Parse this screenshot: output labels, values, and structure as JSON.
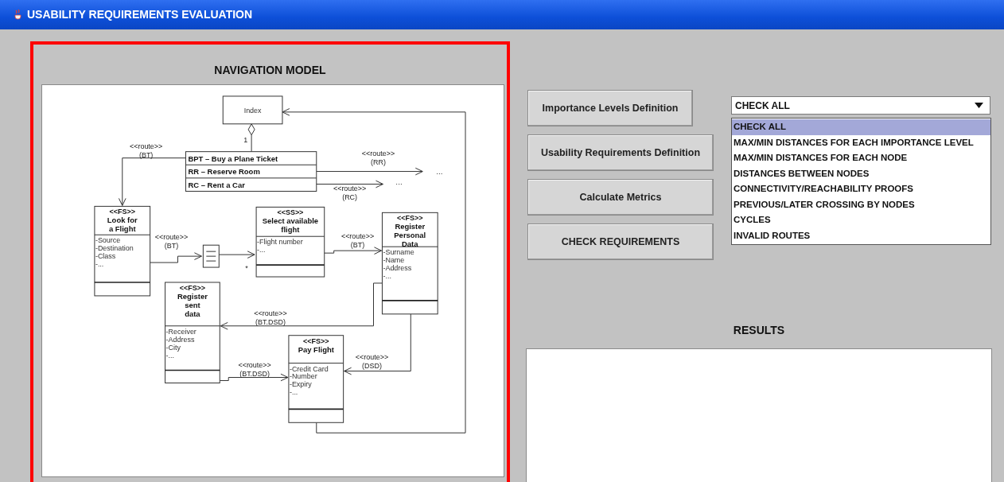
{
  "window": {
    "title": "USABILITY REQUIREMENTS EVALUATION"
  },
  "navigation_model": {
    "title": "NAVIGATION MODEL",
    "diagram": {
      "nodes": [
        {
          "kind": "index",
          "name": "Index"
        },
        {
          "kind": "menu",
          "rows": [
            "BPT – Buy a Plane Ticket",
            "RR – Reserve Room",
            "RC – Rent a Car"
          ]
        },
        {
          "kind": "class",
          "stereotype": "<<FS>>",
          "title_lines": [
            "Look for",
            "a Flight"
          ],
          "attributes": [
            "-Source",
            "-Destination",
            "-Class",
            "-..."
          ]
        },
        {
          "kind": "class",
          "stereotype": "<<SS>>",
          "title_lines": [
            "Select available",
            "flight"
          ],
          "attributes": [
            "-Flight number",
            "-..."
          ]
        },
        {
          "kind": "class",
          "stereotype": "<<FS>>",
          "title_lines": [
            "Register",
            "Personal",
            "Data"
          ],
          "attributes": [
            "-Surname",
            "-Name",
            "-Address",
            "-..."
          ]
        },
        {
          "kind": "class",
          "stereotype": "<<FS>>",
          "title_lines": [
            "Register",
            "sent",
            "data"
          ],
          "attributes": [
            "-Receiver",
            "-Address",
            "-City",
            "-..."
          ]
        },
        {
          "kind": "class",
          "stereotype": "<<FS>>",
          "title_lines": [
            "Pay Flight"
          ],
          "attributes": [
            "-Credit Card",
            "-Number",
            "-Expiry",
            "-..."
          ]
        },
        {
          "kind": "list"
        }
      ],
      "edges": [
        {
          "kind": "aggregation",
          "multiplicity": "1"
        },
        {
          "kind": "route",
          "label_lines": [
            "<<route>>",
            "(BT)"
          ]
        },
        {
          "kind": "route",
          "label_lines": [
            "<<route>>",
            "(RR)"
          ],
          "end_text": "..."
        },
        {
          "kind": "route",
          "label_lines": [
            "<<route>>",
            "(RC)"
          ],
          "end_text": "..."
        },
        {
          "kind": "route",
          "label_lines": [
            "<<route>>",
            "(BT)"
          ]
        },
        {
          "kind": "route",
          "multiplicity": "*"
        },
        {
          "kind": "route",
          "label_lines": [
            "<<route>>",
            "(BT)"
          ]
        },
        {
          "kind": "route",
          "label_lines": [
            "<<route>>",
            "(BT.DSD)"
          ]
        },
        {
          "kind": "route",
          "label_lines": [
            "<<route>>",
            "(DSD)"
          ]
        },
        {
          "kind": "route",
          "label_lines": [
            "<<route>>",
            "(BT.DSD)"
          ]
        },
        {
          "kind": "route"
        }
      ]
    }
  },
  "buttons": [
    {
      "label": "Importance Levels Definition"
    },
    {
      "label": "Usability Requirements Definition"
    },
    {
      "label": "Calculate Metrics"
    },
    {
      "label": "CHECK REQUIREMENTS"
    }
  ],
  "check_dropdown": {
    "value": "CHECK ALL",
    "options": [
      {
        "label": "CHECK ALL",
        "selected": true
      },
      {
        "label": "MAX/MIN DISTANCES FOR EACH IMPORTANCE LEVEL",
        "selected": false
      },
      {
        "label": "MAX/MIN DISTANCES FOR EACH NODE",
        "selected": false
      },
      {
        "label": "DISTANCES BETWEEN NODES",
        "selected": false
      },
      {
        "label": "CONNECTIVITY/REACHABILITY PROOFS",
        "selected": false
      },
      {
        "label": "PREVIOUS/LATER CROSSING BY NODES",
        "selected": false
      },
      {
        "label": "CYCLES",
        "selected": false
      },
      {
        "label": "INVALID ROUTES",
        "selected": false
      }
    ]
  },
  "results": {
    "title": "RESULTS"
  }
}
